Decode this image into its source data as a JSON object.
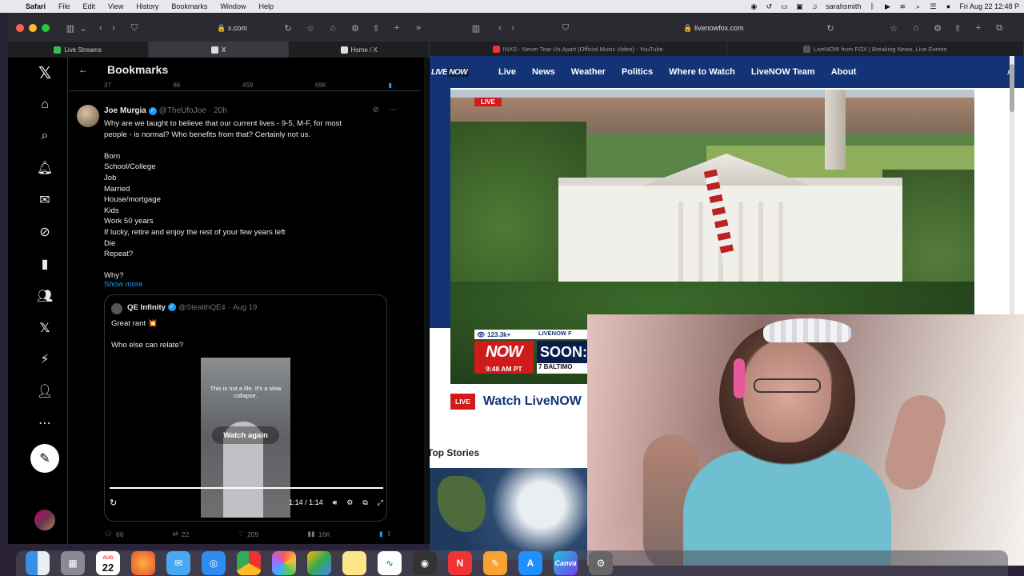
{
  "menubar": {
    "app_name": "Safari",
    "menus": [
      "File",
      "Edit",
      "View",
      "History",
      "Bookmarks",
      "Window",
      "Help"
    ],
    "user": "sarahsmith",
    "clock": "Fri Aug 22  12:48 P"
  },
  "left_window": {
    "url": "x.com",
    "tabs": [
      {
        "label": "Live Streams",
        "fav_color": "#3fb950"
      },
      {
        "label": "X",
        "fav_color": "#ffffff"
      },
      {
        "label": "Home / X",
        "fav_color": "#ffffff"
      }
    ],
    "page": {
      "header_title": "Bookmarks",
      "prev_actions": [
        "37",
        "86",
        "459",
        "69K"
      ],
      "post": {
        "name": "Joe Murgia",
        "handle": "@TheUfoJoe",
        "time": "20h",
        "lines": [
          "Why are we taught to believe that our current lives - 9-5, M-F, for most",
          "people - is normal? Who benefits from that? Certainly not us.",
          "",
          "Born",
          "School/College",
          "Job",
          "Married",
          "House/mortgage",
          "Kids",
          "Work 50 years",
          "If lucky, retire and enjoy the rest of your few years left",
          "Die",
          "Repeat?",
          "",
          "Why?"
        ],
        "show_more": "Show more",
        "quote": {
          "name": "QE Infinity",
          "handle": "@StealthQE4",
          "date": "Aug 19",
          "line1": "Great rant 💥",
          "line2": "Who else can relate?",
          "video_caption": "This is not a life. It's a slow collapse.",
          "watch_again": "Watch again",
          "time": "1:14 / 1:14"
        },
        "actions": {
          "replies": "66",
          "reposts": "22",
          "likes": "209",
          "views": "16K"
        }
      }
    }
  },
  "right_window": {
    "url": "livenowfox.com",
    "tabs": [
      {
        "label": "INXS - Never Tear Us Apart (Official Music Video) - YouTube"
      },
      {
        "label": "LiveNOW from FOX | Breaking News, Live Events"
      }
    ],
    "nav": {
      "logo_live": "LIVE",
      "logo_now": "NOW",
      "links": [
        "Live",
        "News",
        "Weather",
        "Politics",
        "Where to Watch",
        "LiveNOW Team",
        "About"
      ]
    },
    "video": {
      "live_tag": "LIVE",
      "viewers": "123.3k+",
      "brand": "LIVENOW F",
      "live_now": "NOW",
      "live_small": "LIVE",
      "time": "9:48 AM PT",
      "soon": "SOON:",
      "bottom": "7  BALTIMO"
    },
    "watch_badge": "LIVE",
    "watch_text": "Watch LiveNOW",
    "top_stories": "Top Stories"
  },
  "dock": {
    "calendar_month": "AUG",
    "calendar_day": "22",
    "canva_label": "Canva"
  }
}
